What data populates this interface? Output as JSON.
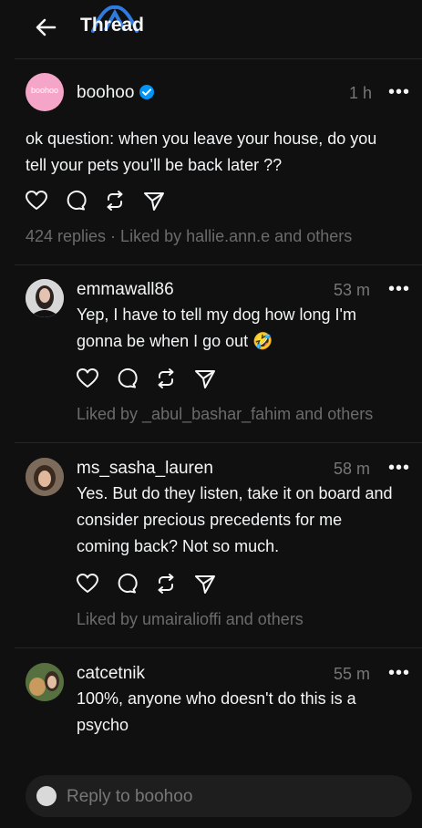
{
  "header": {
    "title": "Thread"
  },
  "original_post": {
    "username": "boohoo",
    "avatar_text": "boohoo",
    "time": "1 h",
    "lines": [
      "ok question: when you leave your house, do you",
      "tell your pets you’ll be back later ??"
    ],
    "meta": "424 replies · Liked by hallie.ann.e and others"
  },
  "replies": [
    {
      "username": "emmawall86",
      "time": "53 m",
      "lines": [
        "Yep, I have to tell my dog how long I'm",
        "gonna be when I go out 🤣"
      ],
      "meta": "Liked by _abul_bashar_fahim and others"
    },
    {
      "username": "ms_sasha_lauren",
      "time": "58 m",
      "lines": [
        "Yes. But do they listen, take it on board and",
        "consider precious precedents for me",
        "coming back? Not so much."
      ],
      "meta": "Liked by umairalioffi and others"
    },
    {
      "username": "catcetnik",
      "time": "55 m",
      "lines": [
        "100%, anyone who doesn't do this is a",
        "psycho"
      ]
    }
  ],
  "reply_bar": {
    "placeholder": "Reply to boohoo"
  },
  "colors": {
    "accent_verified": "#0095f6",
    "boohoo_pink": "#f5a6c8"
  }
}
